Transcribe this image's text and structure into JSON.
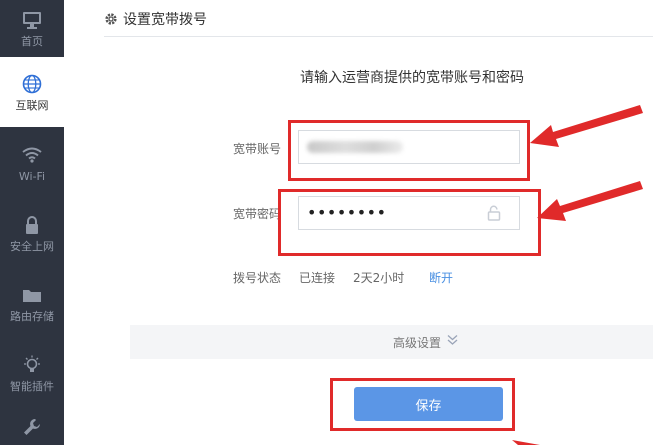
{
  "sidebar": {
    "items": [
      {
        "label": "首页",
        "icon": "monitor-icon"
      },
      {
        "label": "互联网",
        "icon": "globe-icon"
      },
      {
        "label": "Wi-Fi",
        "icon": "wifi-icon"
      },
      {
        "label": "安全上网",
        "icon": "lock-icon"
      },
      {
        "label": "路由存储",
        "icon": "folder-icon"
      },
      {
        "label": "智能插件",
        "icon": "bulb-icon"
      },
      {
        "label": "",
        "icon": "wrench-icon"
      }
    ],
    "active_index": 1
  },
  "header": {
    "title": "设置宽带拨号",
    "icon": "gear-icon"
  },
  "form": {
    "subtitle": "请输入运营商提供的宽带账号和密码",
    "account_label": "宽带账号",
    "password_label": "宽带密码",
    "password_value": "••••••••",
    "status_label": "拨号状态",
    "status_value": "已连接",
    "uptime": "2天2小时",
    "disconnect_label": "断开"
  },
  "advanced": {
    "label": "高级设置"
  },
  "save_label": "保存",
  "colors": {
    "sidebar_bg": "#2e3440",
    "accent": "#5b96e6",
    "annotation_red": "#e02a2a",
    "link_blue": "#4a90e2"
  }
}
